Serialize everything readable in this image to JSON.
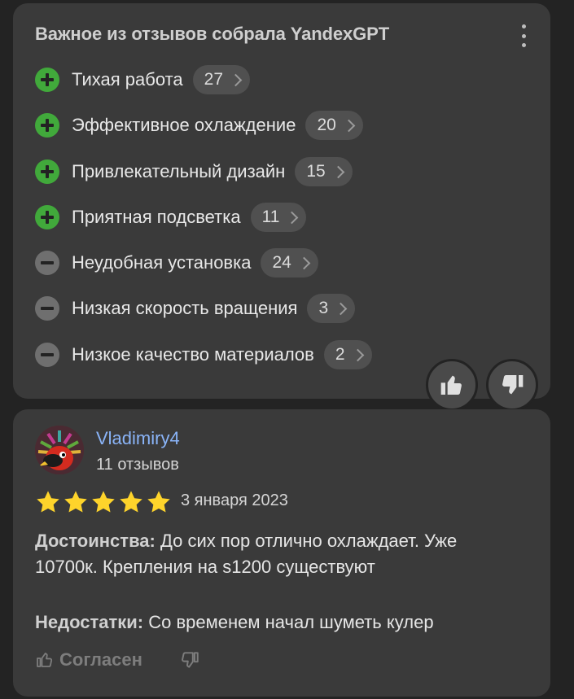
{
  "summary": {
    "title": "Важное из отзывов собрала YandexGPT",
    "aspects": [
      {
        "label": "Тихая работа",
        "count": "27",
        "type": "plus"
      },
      {
        "label": "Эффективное охлаждение",
        "count": "20",
        "type": "plus"
      },
      {
        "label": "Привлекательный дизайн",
        "count": "15",
        "type": "plus"
      },
      {
        "label": "Приятная подсветка",
        "count": "11",
        "type": "plus"
      },
      {
        "label": "Неудобная установка",
        "count": "24",
        "type": "minus"
      },
      {
        "label": "Низкая скорость вращения",
        "count": "3",
        "type": "minus"
      },
      {
        "label": "Низкое качество материалов",
        "count": "2",
        "type": "minus"
      }
    ],
    "icons": {
      "menu": "kebab-menu-icon",
      "like": "thumbs-up-icon",
      "dislike": "thumbs-down-icon"
    },
    "colors": {
      "plus": "#41a93b",
      "minus": "#6f6f6f",
      "card": "#3a3a3a",
      "pill": "#505050"
    }
  },
  "review": {
    "author": "Vladimiry4",
    "author_reviews": "11 отзывов",
    "rating": 5,
    "date": "3 января 2023",
    "pros_label": "Достоинства:",
    "pros_text": "До сих пор отлично охлаждает. Уже 10700к. Крепления на s1200 существуют",
    "cons_label": "Недостатки:",
    "cons_text": "Со временем начал шуметь кулер",
    "agree_label": "Согласен",
    "colors": {
      "author": "#8ab4f8",
      "star": "#fed42b"
    }
  }
}
